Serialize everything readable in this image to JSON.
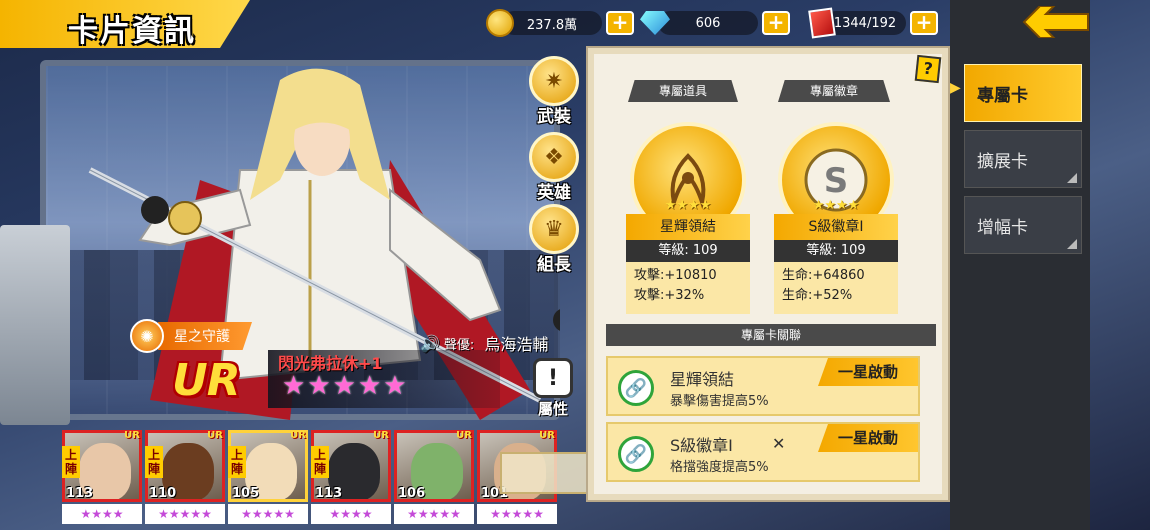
{
  "header": {
    "title": "卡片資訊",
    "resources": [
      {
        "icon": "coin-icon",
        "value": "237.8萬"
      },
      {
        "icon": "diamond-icon",
        "value": "606"
      },
      {
        "icon": "card-ticket-icon",
        "value": "1344/192"
      }
    ],
    "plus_label": "+"
  },
  "side_menu": [
    {
      "label": "武裝",
      "icon": "armament-icon"
    },
    {
      "label": "英雄",
      "icon": "hero-icon"
    },
    {
      "label": "組長",
      "icon": "leader-icon"
    }
  ],
  "character": {
    "guardian_label": "星之守護",
    "voice_label": "聲優:",
    "voice_actor": "烏海浩輔",
    "rarity": "UR",
    "name": "閃光弗拉休+1",
    "stars": 5,
    "attribute_label": "屬性"
  },
  "team": [
    {
      "level": "113",
      "onfield": "上陣",
      "tag": "UR",
      "stars": 4,
      "selected": false
    },
    {
      "level": "110",
      "onfield": "上陣",
      "tag": "UR",
      "stars": 5,
      "selected": false
    },
    {
      "level": "105",
      "onfield": "上陣",
      "tag": "UR",
      "stars": 5,
      "selected": true
    },
    {
      "level": "113",
      "onfield": "上陣",
      "tag": "UR",
      "stars": 4,
      "selected": false
    },
    {
      "level": "106",
      "onfield": "",
      "tag": "UR",
      "stars": 5,
      "selected": false
    },
    {
      "level": "101",
      "onfield": "",
      "tag": "UR",
      "stars": 5,
      "selected": false
    }
  ],
  "panel": {
    "help": "?",
    "exclusive_item_header": "專屬道具",
    "exclusive_badge_header": "專屬徽章",
    "item": {
      "name": "星輝領結",
      "level_label": "等級:",
      "level": "109",
      "stat1": "攻擊:+10810",
      "stat2": "攻擊:+32%",
      "stars": "★★★★"
    },
    "badge": {
      "name": "S級徽章I",
      "level_label": "等級:",
      "level": "109",
      "stat1": "生命:+64860",
      "stat2": "生命:+52%",
      "stars": "★★★★"
    },
    "link_header": "專屬卡關聯",
    "links": [
      {
        "title": "星輝領結",
        "desc": "暴擊傷害提高5%",
        "status": "一星啟動"
      },
      {
        "title": "S級徽章I",
        "desc": "格擋強度提高5%",
        "status": "一星啟動"
      }
    ]
  },
  "nav": {
    "items": [
      {
        "label": "專屬卡",
        "active": true
      },
      {
        "label": "擴展卡",
        "active": false
      },
      {
        "label": "增幅卡",
        "active": false
      }
    ]
  }
}
